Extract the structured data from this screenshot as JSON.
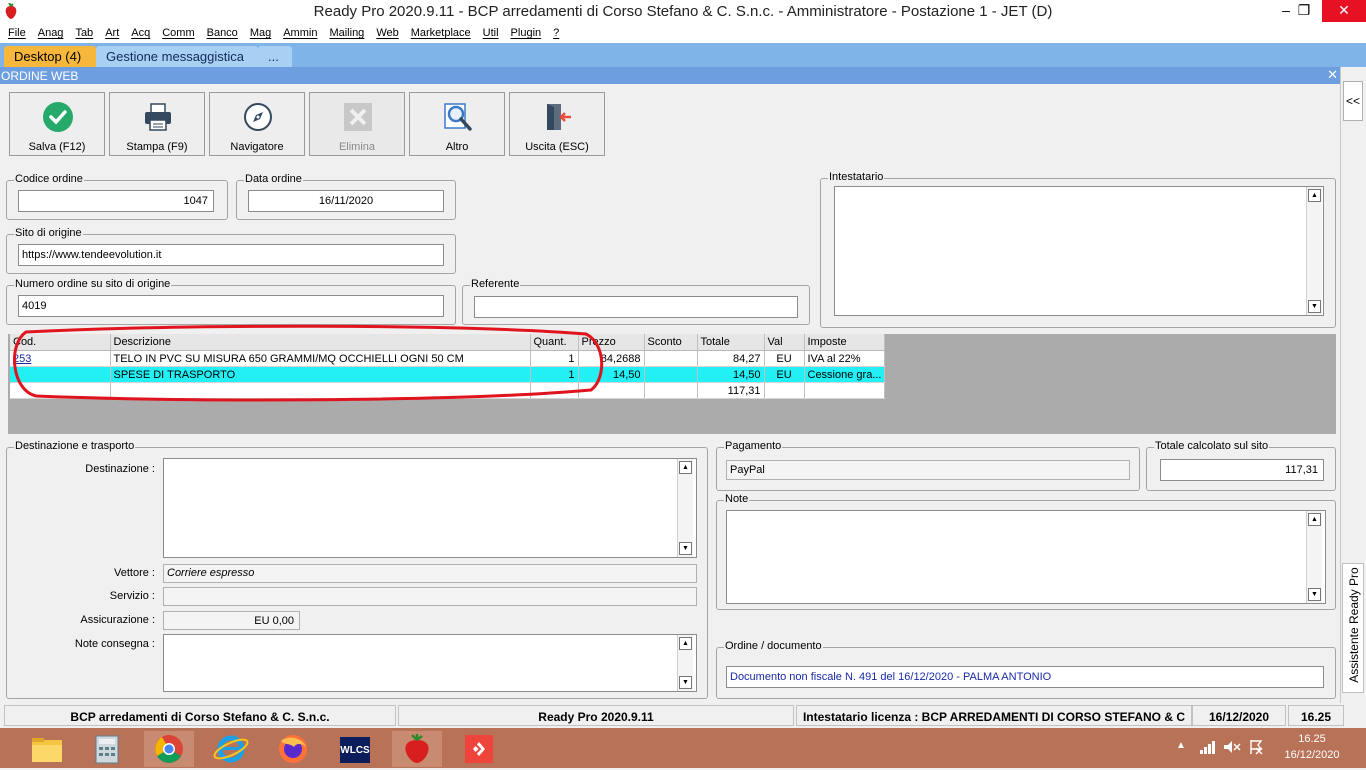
{
  "window": {
    "title": "Ready Pro 2020.9.11 - BCP arredamenti di Corso Stefano & C. S.n.c. - Amministratore - Postazione 1 - JET (D)",
    "minimize": "–",
    "maximize": "❐",
    "close": "✕"
  },
  "menu": [
    "File",
    "Anag",
    "Tab",
    "Art",
    "Acq",
    "Comm",
    "Banco",
    "Mag",
    "Ammin",
    "Mailing",
    "Web",
    "Marketplace",
    "Util",
    "Plugin",
    "?"
  ],
  "tabs": {
    "desktop": "Desktop (4)",
    "messages": "Gestione messaggistica",
    "more": "..."
  },
  "form": {
    "title": "ORDINE WEB",
    "close": "✕",
    "collapse": "<<"
  },
  "toolbar": {
    "save": "Salva (F12)",
    "print": "Stampa (F9)",
    "nav": "Navigatore",
    "delete": "Elimina",
    "other": "Altro",
    "exit": "Uscita (ESC)"
  },
  "fields": {
    "codice_label": "Codice ordine",
    "codice": "1047",
    "data_label": "Data ordine",
    "data": "16/11/2020",
    "sito_label": "Sito di origine",
    "sito": "https://www.tendeevolution.it",
    "numero_label": "Numero ordine su sito di origine",
    "numero": "4019",
    "referente_label": "Referente",
    "referente": "",
    "intestatario_label": "Intestatario"
  },
  "grid": {
    "headers": [
      "Cod.",
      "Descrizione",
      "Quant.",
      "Prezzo",
      "Sconto",
      "Totale",
      "Val",
      "Imposte"
    ],
    "rows": [
      {
        "cod": "253",
        "desc": "TELO IN PVC SU MISURA 650 GRAMMI/MQ OCCHIELLI OGNI 50 CM",
        "qty": "1",
        "prezzo": "84,2688",
        "sconto": "",
        "totale": "84,27",
        "val": "EU",
        "imposte": "IVA al 22%"
      },
      {
        "cod": "",
        "desc": "SPESE DI TRASPORTO",
        "qty": "1",
        "prezzo": "14,50",
        "sconto": "",
        "totale": "14,50",
        "val": "EU",
        "imposte": "Cessione gra..."
      }
    ],
    "total": "117,31"
  },
  "destinazione": {
    "group_label": "Destinazione e trasporto",
    "dest_label": "Destinazione :",
    "vettore_label": "Vettore :",
    "vettore": "Corriere espresso",
    "servizio_label": "Servizio :",
    "servizio": "",
    "assicurazione_label": "Assicurazione :",
    "assicurazione": "EU 0,00",
    "note_label": "Note consegna :"
  },
  "pagamento": {
    "label": "Pagamento",
    "value": "PayPal"
  },
  "totale_sito": {
    "label": "Totale calcolato sul sito",
    "value": "117,31"
  },
  "note": {
    "label": "Note"
  },
  "documento": {
    "label": "Ordine / documento",
    "value": "Documento non fiscale N. 491 del 16/12/2020 - PALMA ANTONIO"
  },
  "assistente": "Assistente Ready Pro",
  "status": {
    "company": "BCP arredamenti di Corso Stefano & C. S.n.c.",
    "version": "Ready Pro 2020.9.11",
    "licenza": "Intestatario licenza : BCP ARREDAMENTI DI CORSO STEFANO & C",
    "date": "16/12/2020",
    "time": "16.25"
  },
  "taskbar": {
    "time": "16.25",
    "date": "16/12/2020",
    "wlcs": "WLCS"
  },
  "colors": {
    "accent": "#6d9fe0",
    "tabbar": "#7eb4e7",
    "selected_row": "#22f0f5",
    "annotation": "#e0141e",
    "taskbar": "#b87258"
  }
}
